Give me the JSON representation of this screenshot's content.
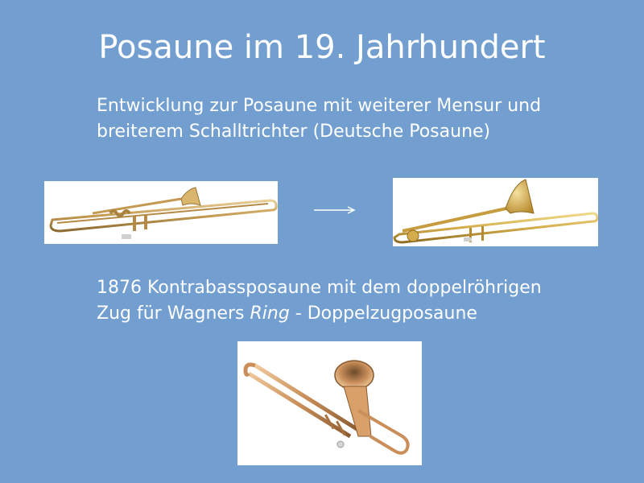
{
  "slide": {
    "title": "Posaune im 19. Jahrhundert",
    "paragraph_1": {
      "line_1": "Entwicklung zur Posaune mit weiterer Mensur und",
      "line_2": "breiterem Schalltrichter (Deutsche Posaune)"
    },
    "paragraph_2": {
      "line_1": "1876 Kontrabassposaune mit dem doppelröhrigen",
      "line_2_prefix": "Zug für Wagners ",
      "line_2_italic": "Ring",
      "line_2_suffix": " - Doppelzugposaune"
    }
  },
  "colors": {
    "background": "#729fd0",
    "text": "#ffffff",
    "brass": "#c9a25a"
  }
}
